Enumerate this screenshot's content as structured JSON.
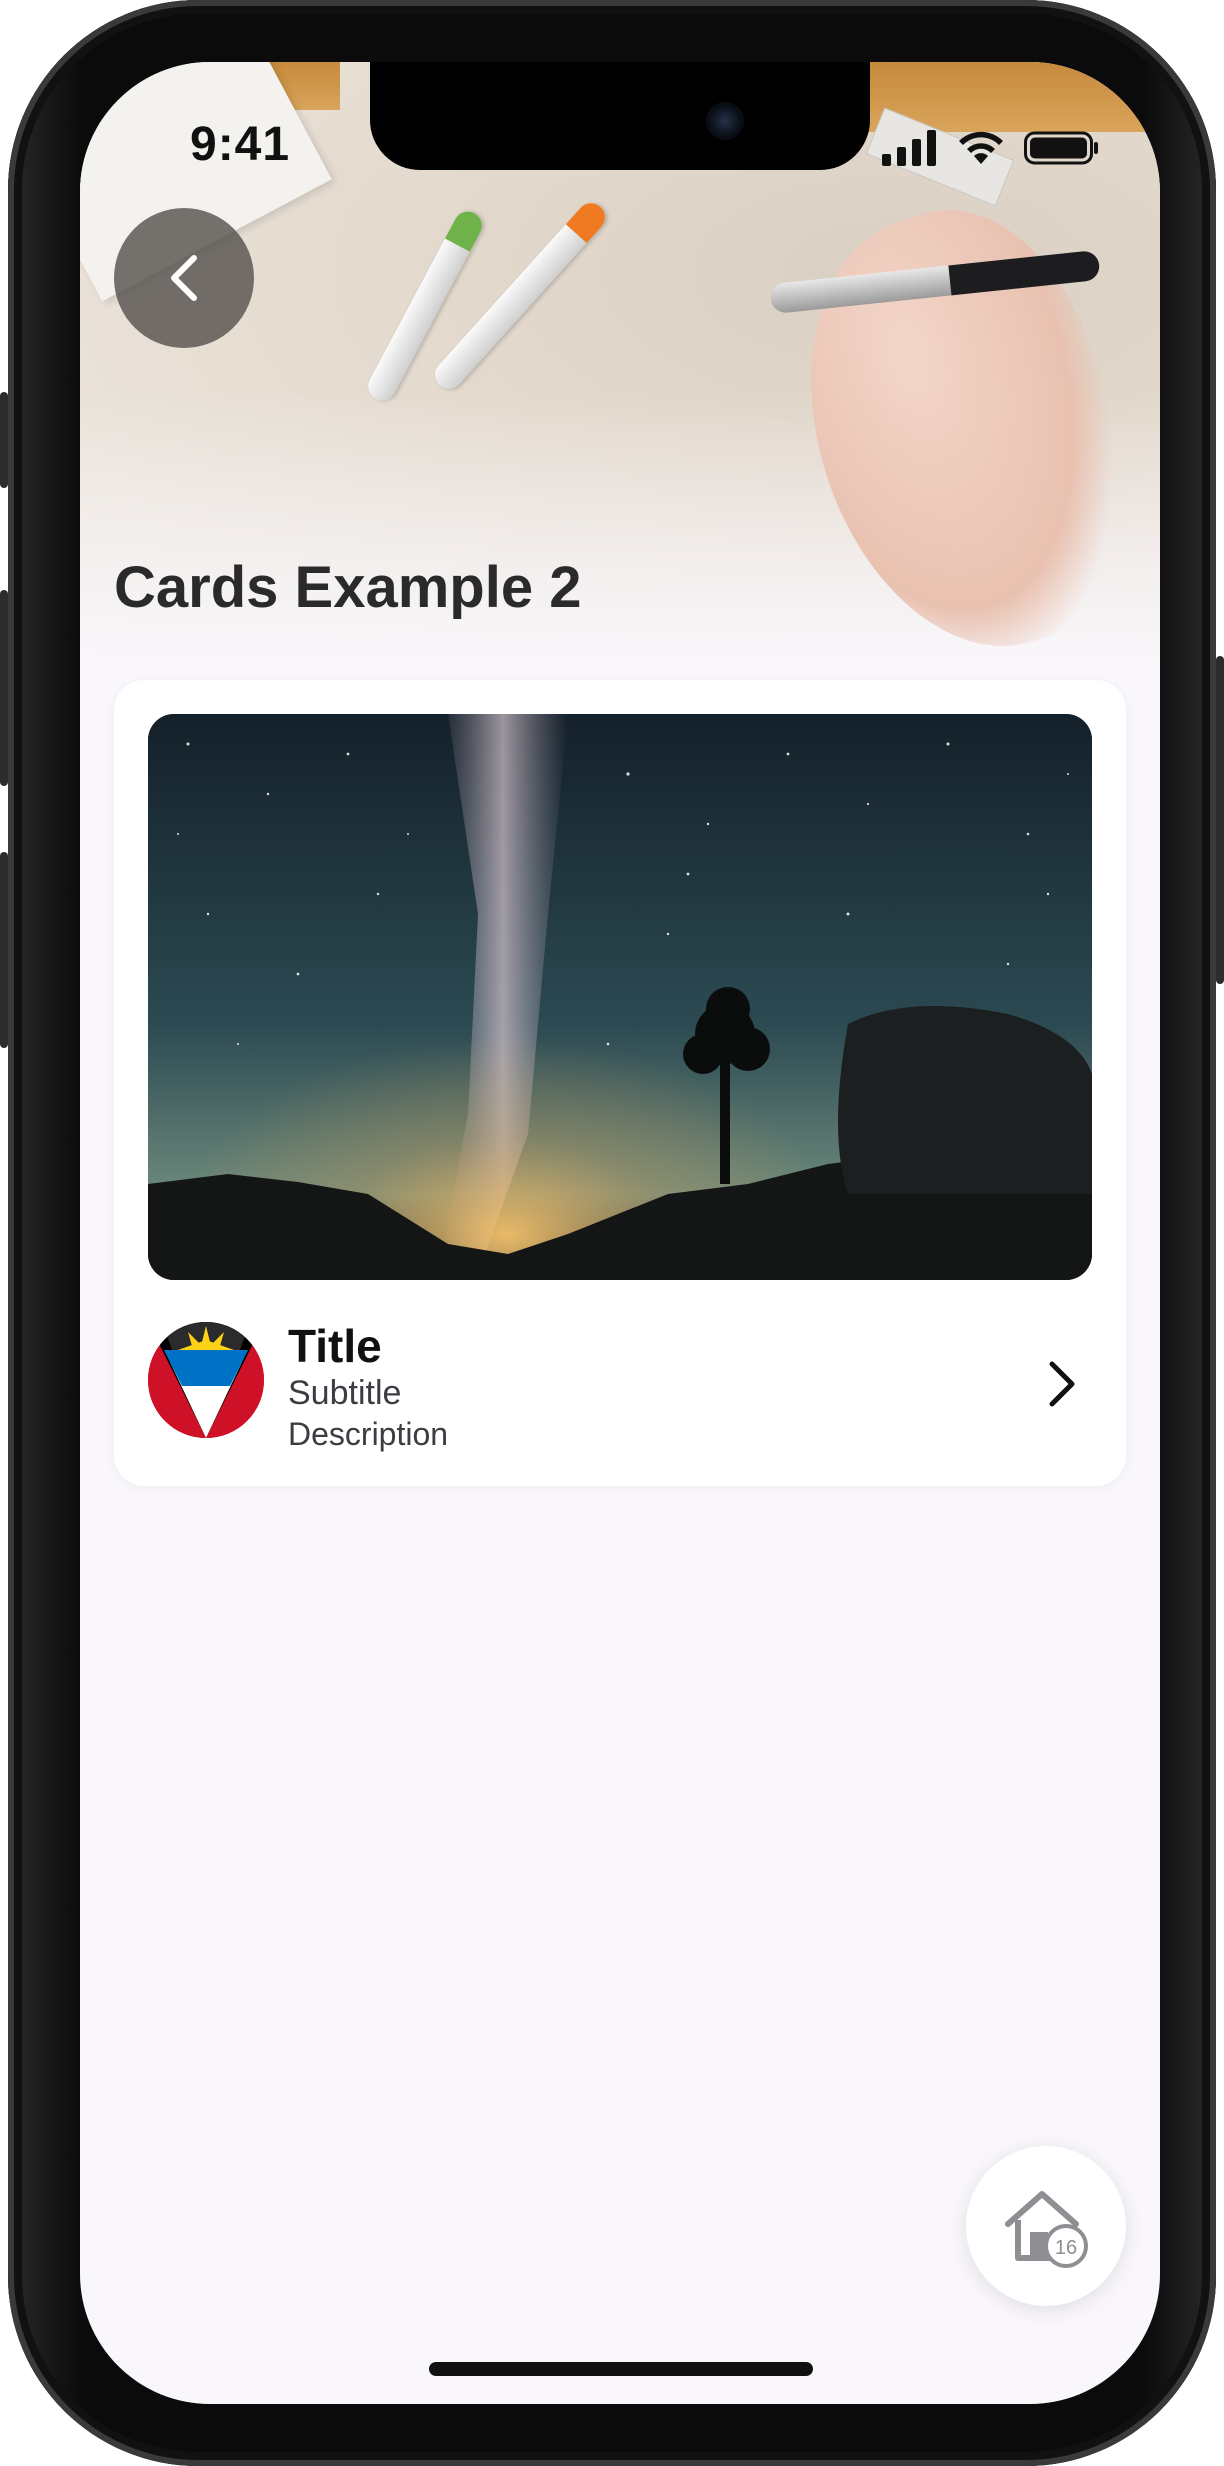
{
  "status_bar": {
    "time": "9:41"
  },
  "header": {
    "title": "Cards Example 2",
    "back_icon": "chevron-left-icon"
  },
  "card": {
    "image_description_icon": "milky-way-photo",
    "title": "Title",
    "subtitle": "Subtitle",
    "description": "Description",
    "chevron_icon": "chevron-right-icon"
  },
  "fab": {
    "icon": "home-icon",
    "badge_count": "16"
  },
  "colors": {
    "screen_bg": "#f9f7fb",
    "card_bg": "#ffffff",
    "back_button_bg": "#504c48",
    "title_text": "#2a2a2c"
  }
}
